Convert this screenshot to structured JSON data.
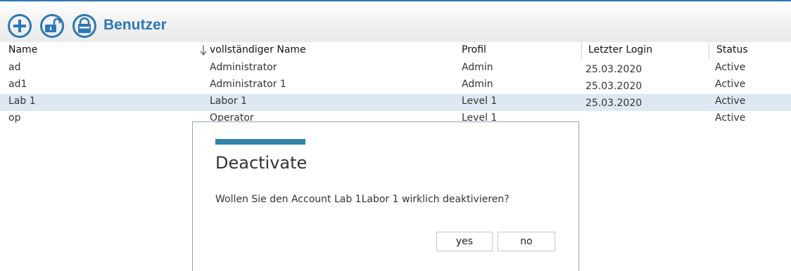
{
  "toolbar": {
    "title": "Benutzer",
    "icons": [
      "add-icon",
      "unlock-icon",
      "lock-icon"
    ],
    "accent_color": "#2a78b8"
  },
  "table": {
    "columns": [
      "Name",
      "vollständiger Name",
      "Profil",
      "Letzter Login",
      "Status"
    ],
    "sort_column": "vollständiger Name",
    "sort_direction": "descending",
    "selected_row": 2,
    "selected_color": "#dde8f2",
    "rows": [
      {
        "name": "ad",
        "full_name": "Administrator",
        "profile": "Admin",
        "last_login": "25.03.2020",
        "status": "Active"
      },
      {
        "name": "ad1",
        "full_name": "Administrator 1",
        "profile": "Admin",
        "last_login": "25.03.2020",
        "status": "Active"
      },
      {
        "name": "Lab 1",
        "full_name": "Labor 1",
        "profile": "Level 1",
        "last_login": "25.03.2020",
        "status": "Active"
      },
      {
        "name": "op",
        "full_name": "Operator",
        "profile": "Level 1",
        "last_login": "",
        "status": "Active"
      }
    ]
  },
  "dialog": {
    "title": "Deactivate",
    "message": "Wollen Sie den Account Lab 1Labor 1 wirklich deaktivieren?",
    "yes_label": "yes",
    "no_label": "no",
    "accent_color": "#2f84a8"
  }
}
